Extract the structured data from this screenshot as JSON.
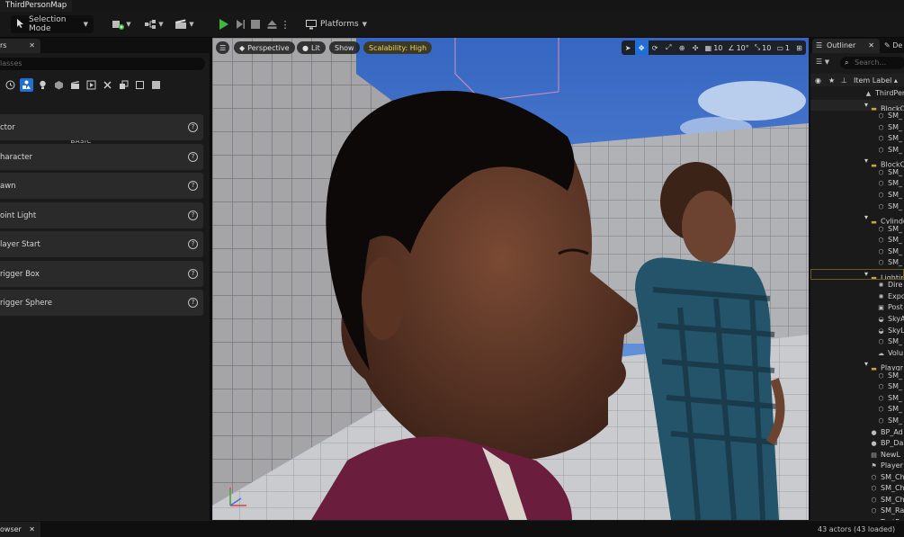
{
  "window": {
    "tab_title": "ThirdPersonMap"
  },
  "toolbar": {
    "mode_label": "Selection Mode",
    "platforms_label": "Platforms"
  },
  "left_panel": {
    "tab_label": "rs",
    "search_placeholder": "lasses",
    "section_label": "BASIC",
    "items": [
      {
        "label": "ctor"
      },
      {
        "label": "haracter"
      },
      {
        "label": "awn"
      },
      {
        "label": "oint Light"
      },
      {
        "label": "layer Start"
      },
      {
        "label": "rigger Box"
      },
      {
        "label": "rigger Sphere"
      }
    ]
  },
  "viewport": {
    "perspective_label": "Perspective",
    "lit_label": "Lit",
    "show_label": "Show",
    "scalability_label": "Scalability: High",
    "grid_snap_value": "10",
    "rotation_snap_value": "10°",
    "scale_snap_value": "10",
    "camera_speed_value": "1"
  },
  "outliner": {
    "tab_label": "Outliner",
    "second_tab_label": "De",
    "search_placeholder": "Search...",
    "column_header": "Item Label ▴",
    "rows": [
      {
        "label": "ThirdPer",
        "icon": "level-icon",
        "indent": 60
      },
      {
        "label": "BlockO",
        "icon": "folder-icon",
        "indent": 66
      },
      {
        "label": "SM_",
        "icon": "mesh-icon",
        "indent": 74
      },
      {
        "label": "SM_",
        "icon": "mesh-icon",
        "indent": 74
      },
      {
        "label": "SM_",
        "icon": "mesh-icon",
        "indent": 74
      },
      {
        "label": "SM_",
        "icon": "mesh-icon",
        "indent": 74
      },
      {
        "label": "BlockO",
        "icon": "folder-icon",
        "indent": 66
      },
      {
        "label": "SM_",
        "icon": "mesh-icon",
        "indent": 74
      },
      {
        "label": "SM_",
        "icon": "mesh-icon",
        "indent": 74
      },
      {
        "label": "SM_",
        "icon": "mesh-icon",
        "indent": 74
      },
      {
        "label": "SM_",
        "icon": "mesh-icon",
        "indent": 74
      },
      {
        "label": "Cylinde",
        "icon": "folder-icon",
        "indent": 66
      },
      {
        "label": "SM_",
        "icon": "mesh-icon",
        "indent": 74
      },
      {
        "label": "SM_",
        "icon": "mesh-icon",
        "indent": 74
      },
      {
        "label": "SM_",
        "icon": "mesh-icon",
        "indent": 74
      },
      {
        "label": "SM_",
        "icon": "mesh-icon",
        "indent": 74
      },
      {
        "label": "Lightin",
        "icon": "folder-icon",
        "indent": 66
      },
      {
        "label": "Dire",
        "icon": "light-icon",
        "indent": 74
      },
      {
        "label": "Expo",
        "icon": "light-icon",
        "indent": 74
      },
      {
        "label": "Post",
        "icon": "volume-icon",
        "indent": 74
      },
      {
        "label": "SkyA",
        "icon": "sky-icon",
        "indent": 74
      },
      {
        "label": "SkyL",
        "icon": "sky-icon",
        "indent": 74
      },
      {
        "label": "SM_",
        "icon": "mesh-icon",
        "indent": 74
      },
      {
        "label": "Volu",
        "icon": "cloud-icon",
        "indent": 74
      },
      {
        "label": "Playgr",
        "icon": "folder-icon",
        "indent": 66
      },
      {
        "label": "SM_",
        "icon": "mesh-icon",
        "indent": 74
      },
      {
        "label": "SM_",
        "icon": "mesh-icon",
        "indent": 74
      },
      {
        "label": "SM_",
        "icon": "mesh-icon",
        "indent": 74
      },
      {
        "label": "SM_",
        "icon": "mesh-icon",
        "indent": 74
      },
      {
        "label": "SM_",
        "icon": "mesh-icon",
        "indent": 74
      },
      {
        "label": "BP_Ad",
        "icon": "blueprint-icon",
        "indent": 66
      },
      {
        "label": "BP_Da",
        "icon": "blueprint-icon",
        "indent": 66
      },
      {
        "label": "NewL",
        "icon": "actor-icon",
        "indent": 66
      },
      {
        "label": "Player",
        "icon": "player-start-icon",
        "indent": 66
      },
      {
        "label": "SM_Ch",
        "icon": "mesh-icon",
        "indent": 66
      },
      {
        "label": "SM_Ch",
        "icon": "mesh-icon",
        "indent": 66
      },
      {
        "label": "SM_Ch",
        "icon": "mesh-icon",
        "indent": 66
      },
      {
        "label": "SM_Ra",
        "icon": "mesh-icon",
        "indent": 66
      },
      {
        "label": "TextRe",
        "icon": "text-render-icon",
        "indent": 66
      }
    ]
  },
  "bottom": {
    "tab_label": "owser",
    "status": "43 actors (43 loaded)"
  },
  "colors": {
    "accent_blue": "#1f6fd6",
    "folder_gold": "#c9a146",
    "scalability_yellow": "#f2d35a",
    "play_green": "#3fb63f"
  }
}
